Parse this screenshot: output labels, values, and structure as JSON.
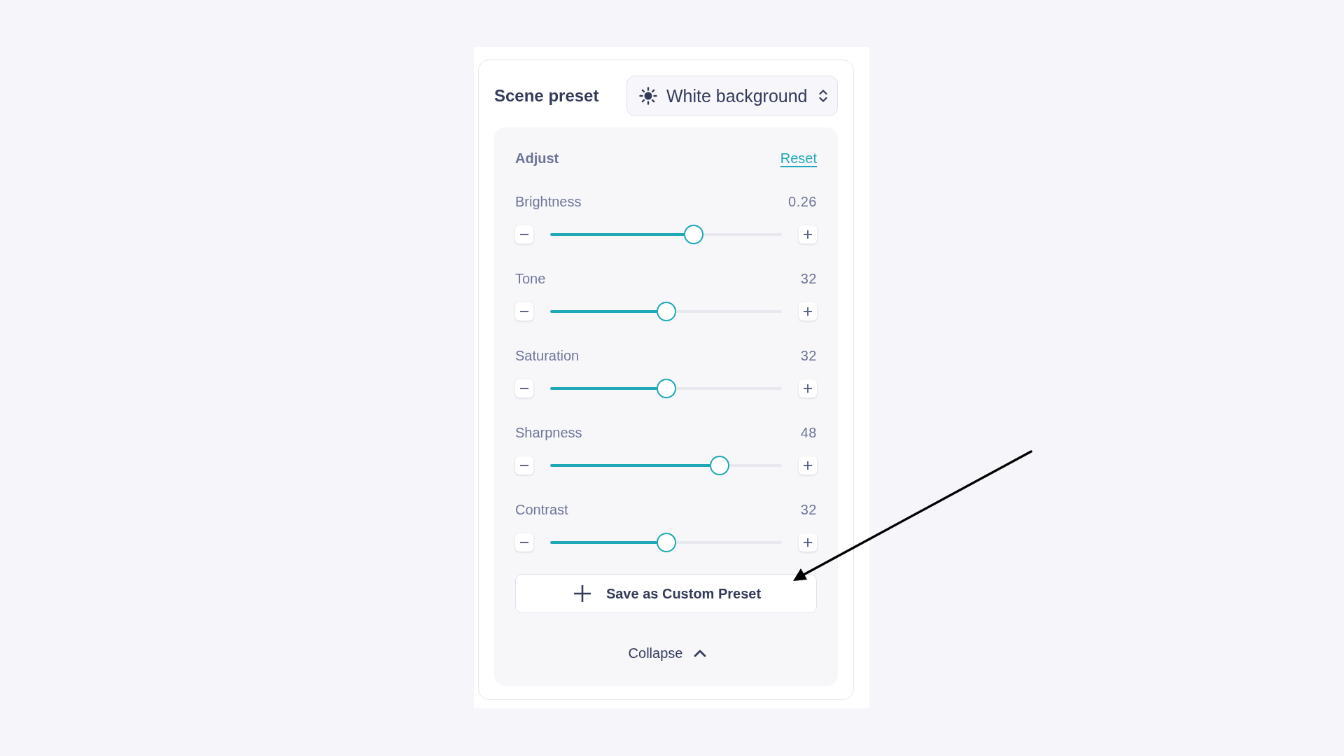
{
  "scene_preset": {
    "label": "Scene preset",
    "value": "White background"
  },
  "adjust": {
    "title": "Adjust",
    "reset_link": "Reset",
    "controls": [
      {
        "name": "Brightness",
        "reading": "0.26",
        "level": 0.62
      },
      {
        "name": "Tone",
        "reading": "32",
        "level": 0.5
      },
      {
        "name": "Saturation",
        "reading": "32",
        "level": 0.5
      },
      {
        "name": "Sharpness",
        "reading": "48",
        "level": 0.73
      },
      {
        "name": "Contrast",
        "reading": "32",
        "level": 0.5
      }
    ],
    "save_button": "Save as Custom Preset",
    "collapse_button": "Collapse"
  }
}
